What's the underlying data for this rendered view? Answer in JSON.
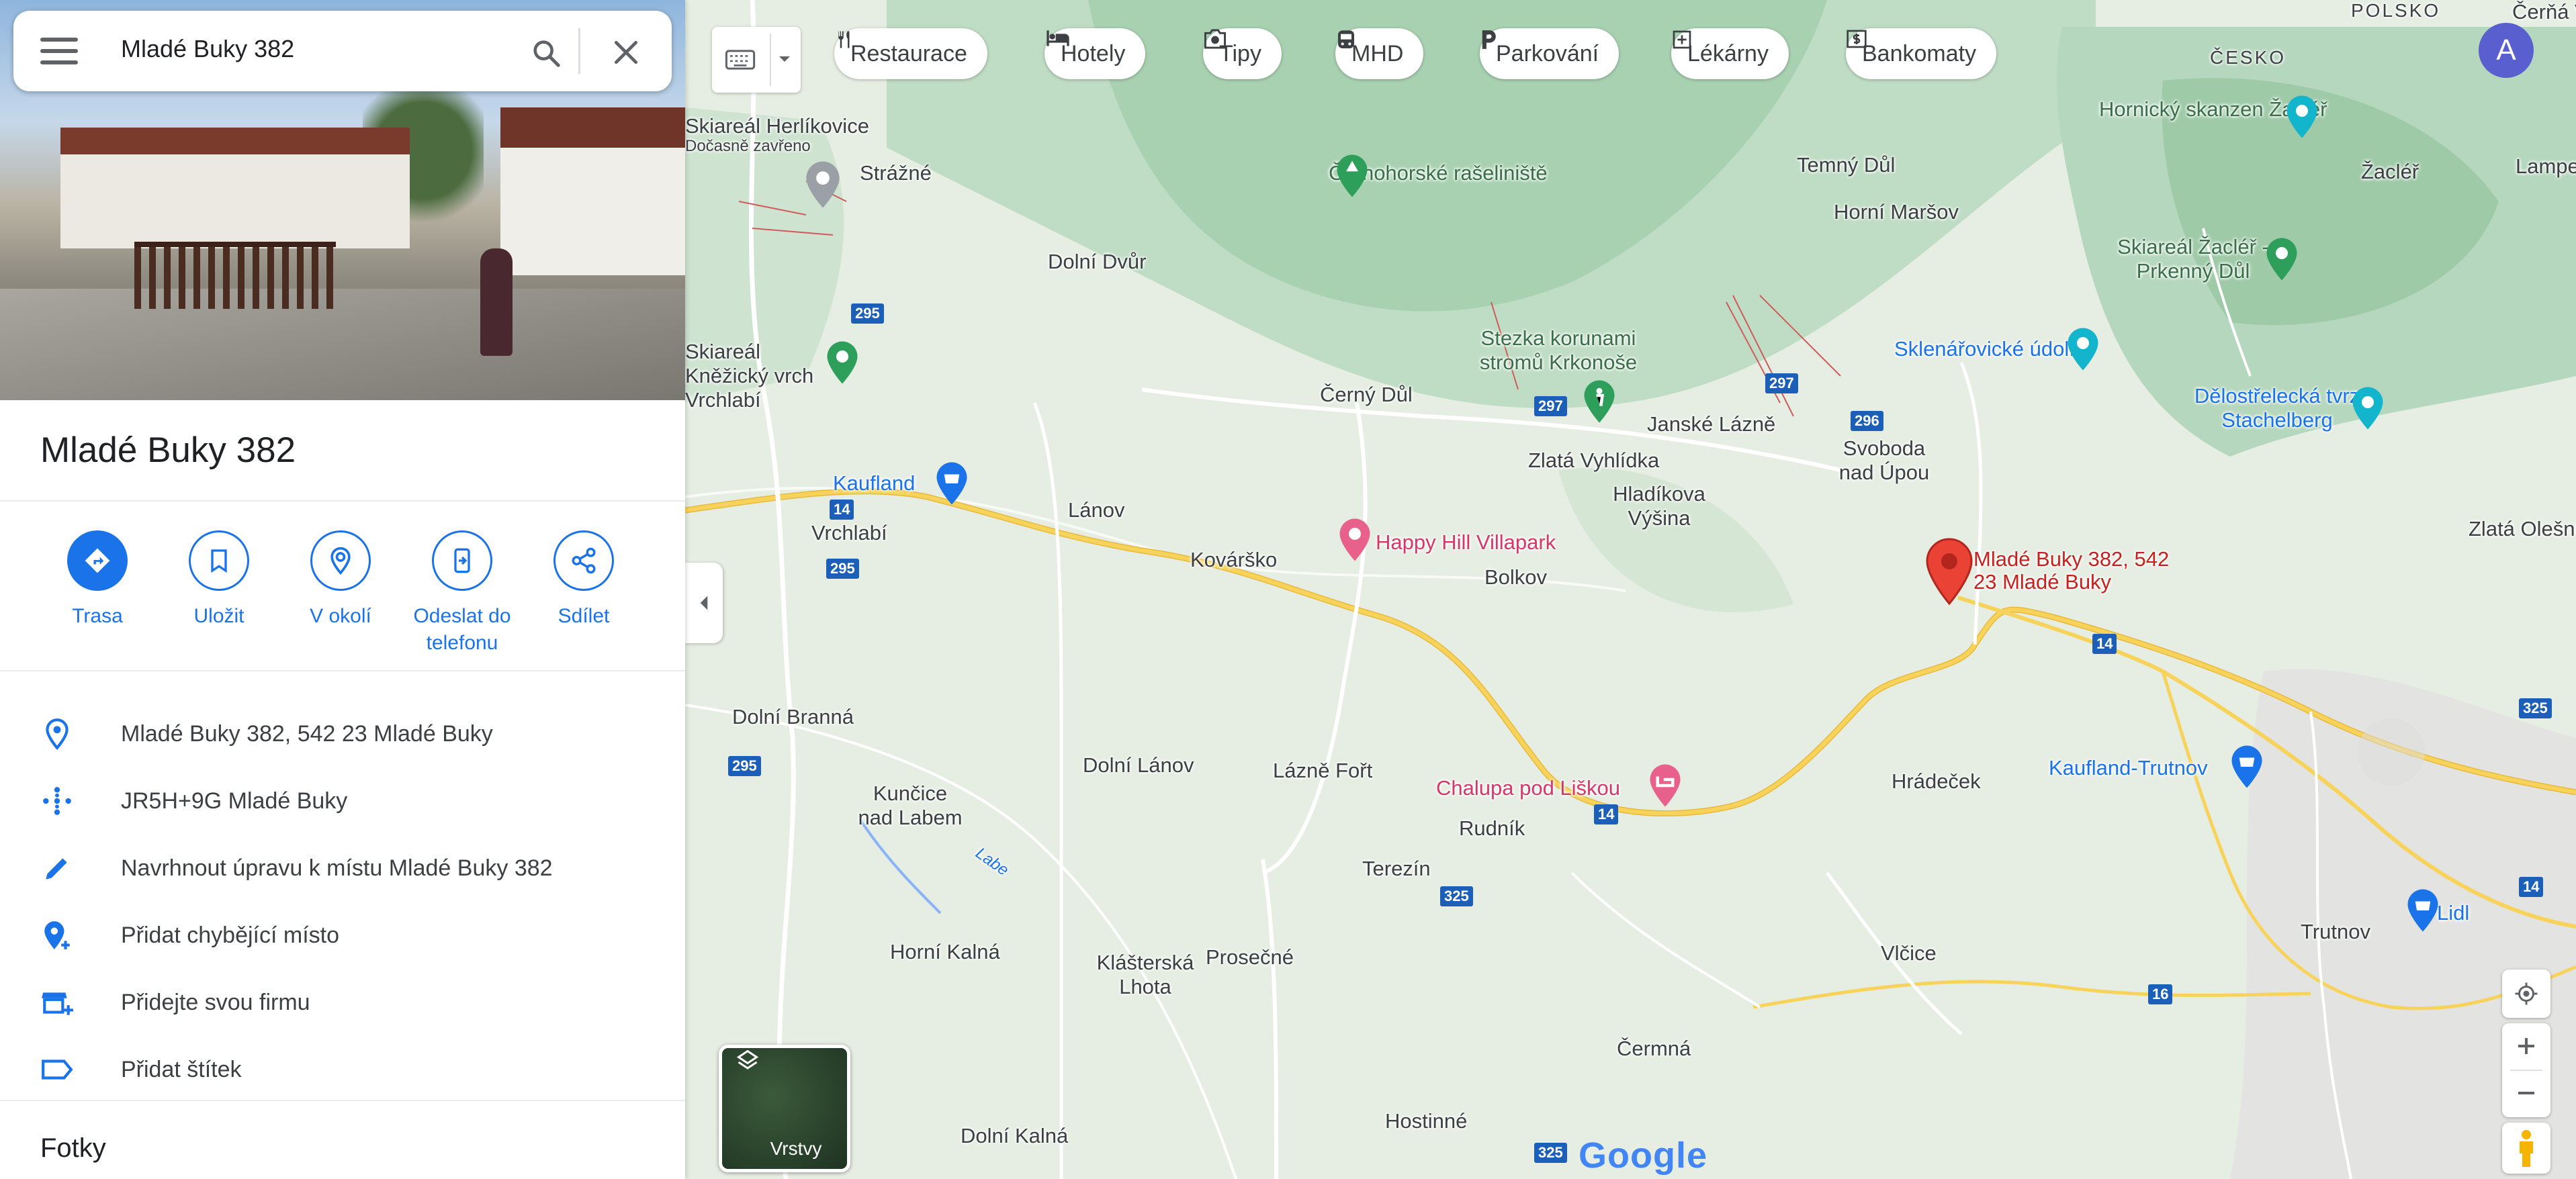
{
  "search": {
    "query": "Mladé Buky 382"
  },
  "place": {
    "title": "Mladé Buky 382"
  },
  "actions": [
    {
      "label": "Trasa"
    },
    {
      "label": "Uložit"
    },
    {
      "label": "V okolí"
    },
    {
      "label": "Odeslat do telefonu"
    },
    {
      "label": "Sdílet"
    }
  ],
  "info": [
    {
      "icon": "location-pin-icon",
      "text": "Mladé Buky 382, 542 23 Mladé Buky"
    },
    {
      "icon": "plus-code-icon",
      "text": "JR5H+9G Mladé Buky"
    },
    {
      "icon": "pencil-icon",
      "text": "Navrhnout úpravu k místu Mladé Buky 382"
    },
    {
      "icon": "add-place-icon",
      "text": "Přidat chybějící místo"
    },
    {
      "icon": "add-business-icon",
      "text": "Přidejte svou firmu"
    },
    {
      "icon": "label-icon",
      "text": "Přidat štítek"
    }
  ],
  "photos_heading": "Fotky",
  "chips": [
    "Restaurace",
    "Hotely",
    "Tipy",
    "MHD",
    "Parkování",
    "Lékárny",
    "Bankomaty"
  ],
  "avatar_letter": "A",
  "layers_label": "Vrstvy",
  "google_logo": "Google",
  "colors": {
    "accent": "#1a73e8",
    "pin": "#ea4335",
    "poi_pink": "#d4386b",
    "poi_green": "#2e9e5b",
    "poi_blue": "#1a73e8",
    "road_yellow": "#f7d35b"
  },
  "map": {
    "places": [
      "Strážné",
      "Dolní Dvůr",
      "Černohorské rašeliniště",
      "Temný Důl",
      "Horní Maršov",
      "Žacléř",
      "Lampert",
      "Čerňá Vodá",
      "Hornický skanzen Žacléř",
      "Skiareál Žacléř - Prkenný Důl",
      "Sklenářovické údolí",
      "Dělostřelecká tvrz Stachelberg",
      "Stezka korunami stromů Krkonoše",
      "Černý Důl",
      "Janské Lázně",
      "Svoboda nad Úpou",
      "Zlatá Vyhlídka",
      "Hladíkova Výšina",
      "Kaufland",
      "Vrchlabí",
      "Lánov",
      "Kovárško",
      "Happy Hill Villapark",
      "Bolkov",
      "Mladé Buky 382, 542 23 Mladé Buky",
      "Zlatá Olešnice",
      "Dolní Branná",
      "Dolní Lánov",
      "Lázně Fořt",
      "Chalupa pod Liškou",
      "Rudník",
      "Hrádeček",
      "Kaufland-Trutnov",
      "Kunčice nad Labem",
      "Terezín",
      "Trutnov",
      "Lidl",
      "Horní Kalná",
      "Klášterská Lhota",
      "Prosečné",
      "Vlčice",
      "Čermná",
      "Hostinné",
      "Dolní Kalná",
      "Skiareál Herlíkovice",
      "Dočasně zavřeno",
      "Skiareál Kněžický vrch Vrchlabí",
      "Labe",
      "POLSKO",
      "ČESKO"
    ],
    "routes": [
      "295",
      "14",
      "297",
      "296",
      "325",
      "16"
    ]
  }
}
